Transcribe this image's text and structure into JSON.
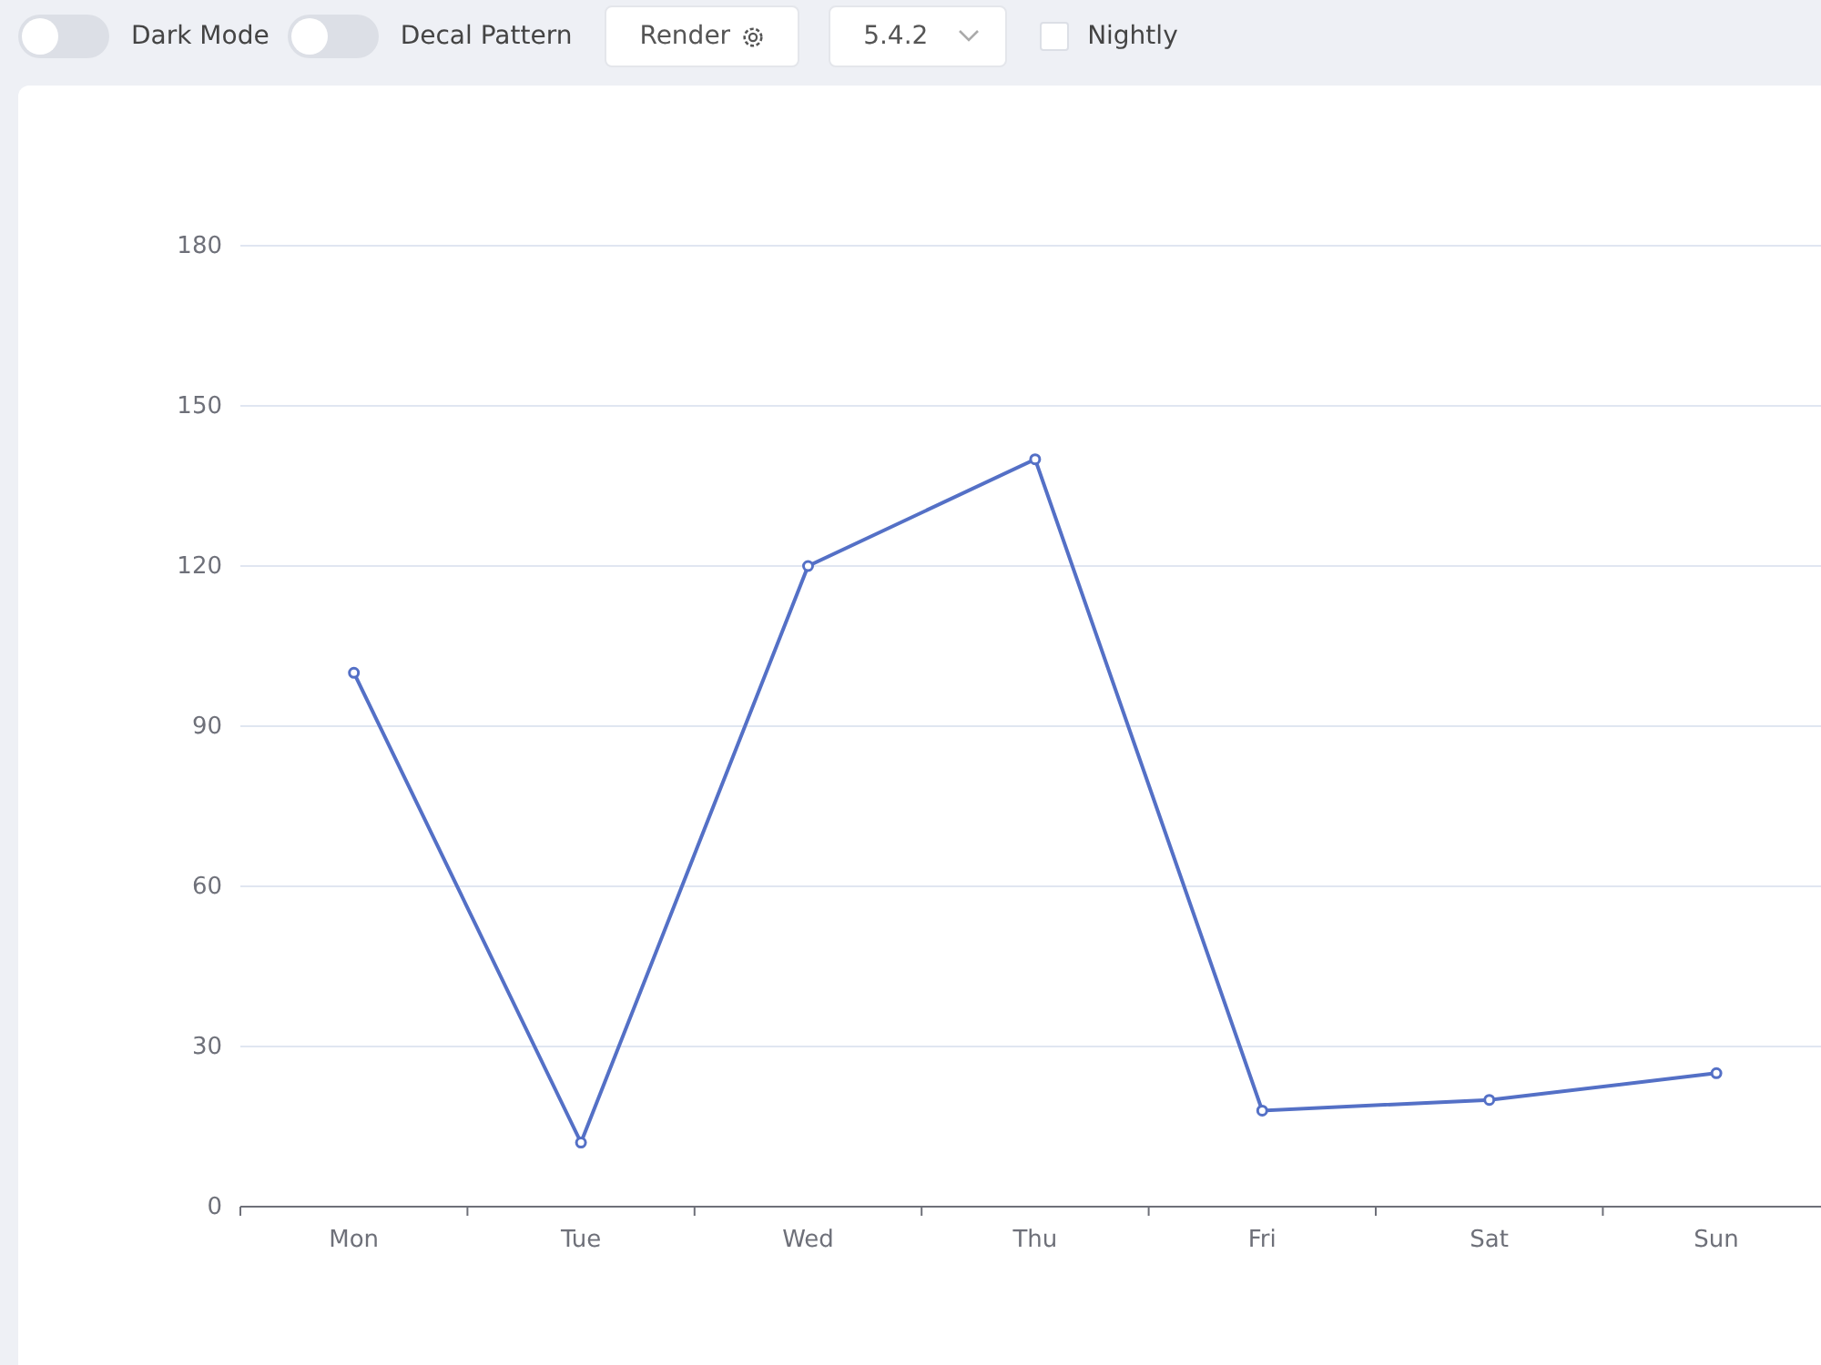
{
  "toolbar": {
    "toggles": [
      {
        "label": "Dark Mode",
        "on": false
      },
      {
        "label": "Decal Pattern",
        "on": false
      }
    ],
    "render_button": {
      "label": "Render"
    },
    "version_select": {
      "value": "5.4.2"
    },
    "nightly": {
      "label": "Nightly",
      "checked": false
    }
  },
  "chart": {
    "chart_data": {
      "type": "line",
      "categories": [
        "Mon",
        "Tue",
        "Wed",
        "Thu",
        "Fri",
        "Sat",
        "Sun"
      ],
      "series": [
        {
          "color": "#5470c6",
          "marker": true,
          "values": [
            100,
            12,
            120,
            140,
            18,
            20,
            25
          ]
        }
      ],
      "grid": true,
      "ylim": [
        0,
        180
      ],
      "yticks": [
        0,
        30,
        60,
        90,
        120,
        150,
        180
      ]
    }
  }
}
